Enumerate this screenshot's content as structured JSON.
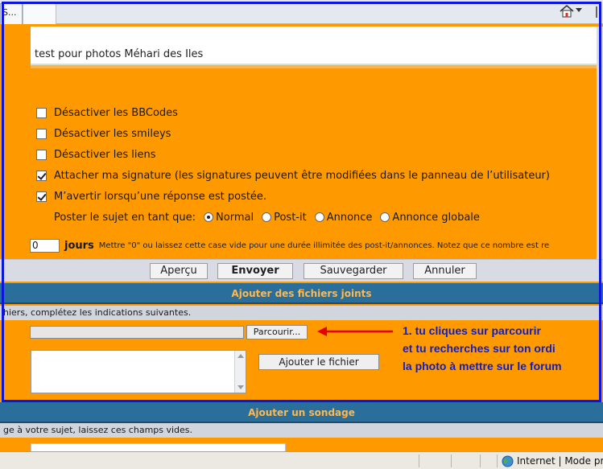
{
  "browser": {
    "tab_label": "S...",
    "status_zone": "Internet | Mode prot"
  },
  "editor": {
    "message_text": "test pour photos Méhari des Iles"
  },
  "options": [
    {
      "label": "Désactiver les BBCodes",
      "checked": false
    },
    {
      "label": "Désactiver les smileys",
      "checked": false
    },
    {
      "label": "Désactiver les liens",
      "checked": false
    },
    {
      "label": "Attacher ma signature (les signatures peuvent être modifiées dans le panneau de l’utilisateur)",
      "checked": true
    },
    {
      "label": "M’avertir lorsqu’une réponse est postée.",
      "checked": true
    }
  ],
  "post_as": {
    "label": "Poster le sujet en tant que:",
    "choices": [
      {
        "label": "Normal",
        "selected": true
      },
      {
        "label": "Post-it",
        "selected": false
      },
      {
        "label": "Annonce",
        "selected": false
      },
      {
        "label": "Annonce globale",
        "selected": false
      }
    ]
  },
  "duration": {
    "value": "0",
    "unit_label": "jours",
    "note": "Mettre \"0\" ou laissez cette case vide pour une durée illimitée des post-it/annonces. Notez que ce nombre est re"
  },
  "buttons": {
    "preview": "Aperçu",
    "send": "Envoyer",
    "save": "Sauvegarder",
    "cancel": "Annuler"
  },
  "attachments": {
    "header": "Ajouter des fichiers joints",
    "note": "hiers, complétez les indications suivantes.",
    "browse_label": "Parcourir...",
    "add_file_label": "Ajouter le fichier"
  },
  "annotation": {
    "line1": "1. tu cliques sur parcourir",
    "line2": "et tu recherches sur ton ordi",
    "line3": "la photo à mettre sur le forum",
    "color": "#0a1ecc"
  },
  "poll": {
    "header": "Ajouter un sondage",
    "note": "ge à votre sujet, laissez ces champs vides."
  },
  "colors": {
    "background": "#ff9900",
    "section_header": "#2a6f9c",
    "section_header_text": "#ffb84d",
    "frame": "#0b14e0"
  }
}
